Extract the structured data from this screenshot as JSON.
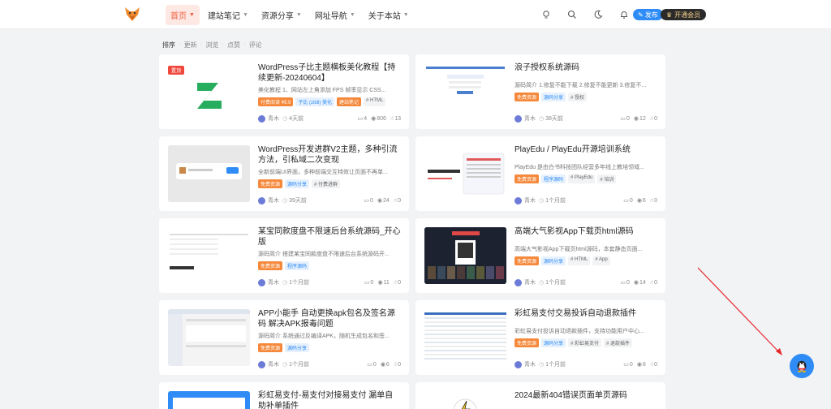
{
  "header": {
    "nav": [
      {
        "label": "首页",
        "active": true
      },
      {
        "label": "建站笔记",
        "active": false
      },
      {
        "label": "资源分享",
        "active": false
      },
      {
        "label": "网址导航",
        "active": false
      },
      {
        "label": "关于本站",
        "active": false
      }
    ],
    "publish_label": "发布",
    "vip_label": "开通会员"
  },
  "sortbar": {
    "items": [
      "排序",
      "更新",
      "浏览",
      "点赞",
      "评论"
    ],
    "sep": "·"
  },
  "cards": [
    {
      "badge": "置顶",
      "title": "WordPress子比主题横板美化教程【持续更新-20240604】",
      "excerpt": "美化教程 1、网站左上角添加 FPS 帧率显示 CSS...",
      "tags": [
        {
          "label": "付费阅读 ¥9.9",
          "style": "orange"
        },
        {
          "label": "子比 (zibll) 美化",
          "style": "blue"
        },
        {
          "label": "建站笔记",
          "style": "orange"
        },
        {
          "label": "# HTML",
          "style": "gray"
        }
      ],
      "author": "青木",
      "time": "4天前",
      "comments": "4",
      "views": "806",
      "likes": "13"
    },
    {
      "title": "浪子授权系统源码",
      "excerpt": "源码简介 1.修复不能下载 2.修复不能更新 3.修复不...",
      "tags": [
        {
          "label": "免费资源",
          "style": "orange"
        },
        {
          "label": "源码分享",
          "style": "blue"
        },
        {
          "label": "# 授权",
          "style": "gray"
        }
      ],
      "author": "青木",
      "time": "38天前",
      "comments": "0",
      "views": "12",
      "likes": "0"
    },
    {
      "title": "WordPress开发进群V2主题，多种引流方法，引私域二次变现",
      "excerpt": "全新前端UI界面，多种前端交互特效让页面不再单...",
      "tags": [
        {
          "label": "免费资源",
          "style": "orange"
        },
        {
          "label": "源码分享",
          "style": "blue"
        },
        {
          "label": "# 付费进群",
          "style": "gray"
        }
      ],
      "author": "青木",
      "time": "39天前",
      "comments": "0",
      "views": "24",
      "likes": "0"
    },
    {
      "title": "PlayEdu / PlayEdu开源培训系统",
      "excerpt": "PlayEdu 是由白书科技团队经营多年线上教培领域...",
      "tags": [
        {
          "label": "免费资源",
          "style": "orange"
        },
        {
          "label": "程序源码",
          "style": "blue"
        },
        {
          "label": "# PlayEdu",
          "style": "gray"
        },
        {
          "label": "# 培训",
          "style": "gray"
        }
      ],
      "author": "青木",
      "time": "1个月前",
      "comments": "0",
      "views": "6",
      "likes": "0"
    },
    {
      "title": "某宝同款度盘不限速后台系统源码_开心版",
      "excerpt": "源码简介 搭建某宝同款度盘不限速后台系统源码开...",
      "tags": [
        {
          "label": "免费资源",
          "style": "orange"
        },
        {
          "label": "程序源码",
          "style": "blue"
        }
      ],
      "author": "青木",
      "time": "1个月前",
      "comments": "0",
      "views": "11",
      "likes": "0"
    },
    {
      "title": "高端大气影视App下载页html源码",
      "excerpt": "高端大气影视App下载页html源码，本套静态页面...",
      "tags": [
        {
          "label": "免费资源",
          "style": "orange"
        },
        {
          "label": "源码分享",
          "style": "blue"
        },
        {
          "label": "# HTML",
          "style": "gray"
        },
        {
          "label": "# App",
          "style": "gray"
        }
      ],
      "author": "青木",
      "time": "1个月前",
      "comments": "0",
      "views": "14",
      "likes": "0"
    },
    {
      "title": "APP小能手 自动更换apk包名及签名源码 解决APK报毒问题",
      "excerpt": "源码简介 系统通过反编译APK，随机生成包名和签...",
      "tags": [
        {
          "label": "免费资源",
          "style": "orange"
        },
        {
          "label": "源码分享",
          "style": "blue"
        }
      ],
      "author": "青木",
      "time": "1个月前",
      "comments": "0",
      "views": "6",
      "likes": "0"
    },
    {
      "title": "彩虹易支付交易投诉自动退款插件",
      "excerpt": "彩虹易支付投诉自动退款插件，支持功能用户中心...",
      "tags": [
        {
          "label": "免费资源",
          "style": "orange"
        },
        {
          "label": "源码分享",
          "style": "blue"
        },
        {
          "label": "# 彩虹易支付",
          "style": "gray"
        },
        {
          "label": "# 退款插件",
          "style": "gray"
        }
      ],
      "author": "青木",
      "time": "1个月前",
      "comments": "0",
      "views": "8",
      "likes": "0"
    },
    {
      "title": "彩虹易支付-易支付对接易支付 漏单自助补单插件",
      "excerpt": "",
      "tags": [],
      "author": "",
      "time": "",
      "comments": "",
      "views": "",
      "likes": ""
    },
    {
      "title": "2024最新404错误页面单页源码",
      "excerpt": "",
      "tags": [],
      "author": "",
      "time": "",
      "comments": "",
      "views": "",
      "likes": ""
    }
  ],
  "colors": {
    "accent": "#f05c3c",
    "blue": "#2f8cf6",
    "orange": "#f5883a",
    "page_bg": "#f2f3f5"
  }
}
